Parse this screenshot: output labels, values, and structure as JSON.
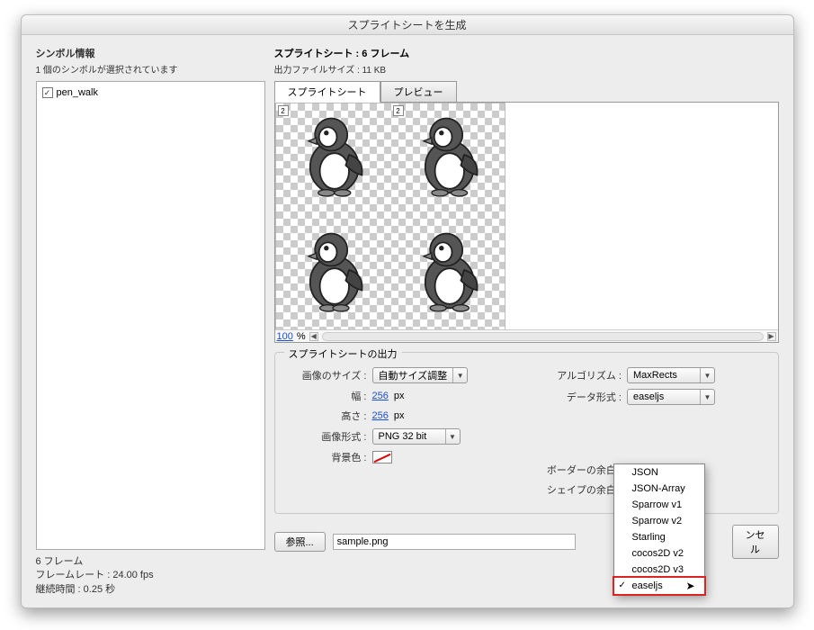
{
  "window": {
    "title": "スプライトシートを生成"
  },
  "left": {
    "symbol_info_label": "シンボル情報",
    "symbol_selected_text": "1 個のシンボルが選択されています",
    "symbol_item": {
      "checked": true,
      "name": "pen_walk"
    },
    "stats": {
      "frames": "6 フレーム",
      "framerate": "フレームレート : 24.00 fps",
      "duration": "継続時間 : 0.25 秒"
    }
  },
  "right": {
    "header_line1": "スプライトシート : 6 フレーム",
    "header_line2": "出力ファイルサイズ : 11 KB",
    "tabs": {
      "sheet": "スプライトシート",
      "preview": "プレビュー"
    },
    "badge": "2",
    "zoom": {
      "value": "100",
      "percent": "%"
    }
  },
  "output": {
    "group_title": "スプライトシートの出力",
    "image_size_label": "画像のサイズ :",
    "image_size_value": "自動サイズ調整",
    "width_label": "幅 :",
    "width_value": "256",
    "px": "px",
    "height_label": "高さ :",
    "height_value": "256",
    "format_label": "画像形式 :",
    "format_value": "PNG 32 bit",
    "bg_label": "背景色 :",
    "algo_label": "アルゴリズム :",
    "algo_value": "MaxRects",
    "dataformat_label": "データ形式 :",
    "dataformat_value": "easeljs",
    "border_label": "ボーダーの余白 :",
    "shape_label": "シェイプの余白 :"
  },
  "file": {
    "browse": "参照...",
    "filename": "sample.png",
    "cancel": "ンセル"
  },
  "dropdown": {
    "items": [
      "JSON",
      "JSON-Array",
      "Sparrow v1",
      "Sparrow v2",
      "Starling",
      "cocos2D v2",
      "cocos2D v3",
      "easeljs"
    ],
    "selected": "easeljs"
  }
}
